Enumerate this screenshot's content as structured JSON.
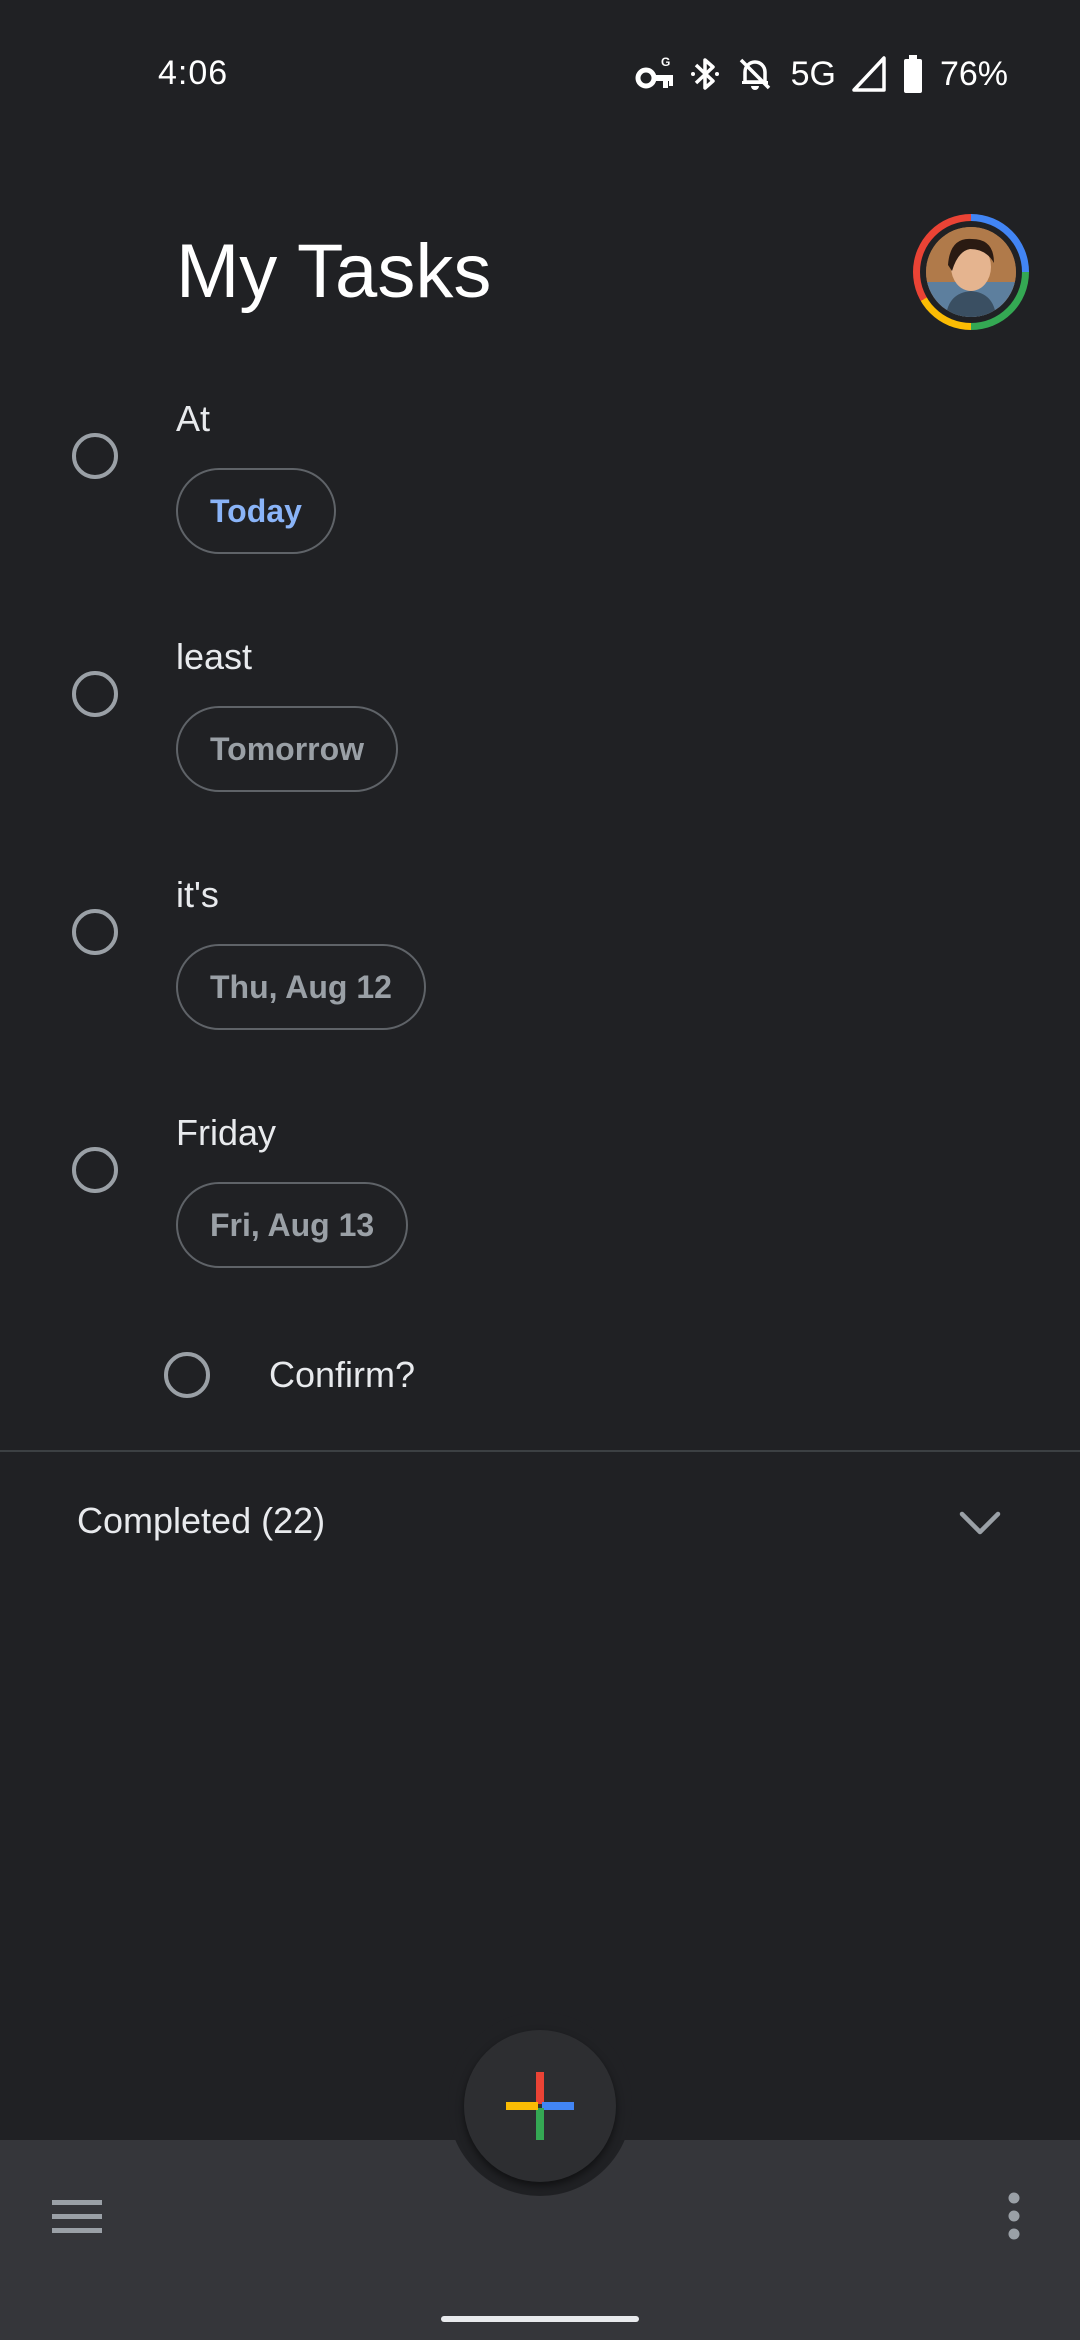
{
  "status_bar": {
    "time": "4:06",
    "network": "5G",
    "battery": "76%",
    "icons": [
      "vpn-key-icon",
      "bluetooth-icon",
      "notifications-off-icon",
      "signal-icon",
      "battery-icon"
    ]
  },
  "header": {
    "title": "My Tasks",
    "avatar": "account-avatar"
  },
  "tasks": [
    {
      "title": "At",
      "date": "Today",
      "date_color": "#8ab4f8"
    },
    {
      "title": "least",
      "date": "Tomorrow",
      "date_color": "#9aa0a6"
    },
    {
      "title": "it's",
      "date": "Thu, Aug 12",
      "date_color": "#9aa0a6"
    },
    {
      "title": "Friday",
      "date": "Fri, Aug 13",
      "date_color": "#9aa0a6"
    }
  ],
  "subtask": {
    "title": "Confirm?"
  },
  "completed": {
    "label": "Completed (22)"
  },
  "fab": {
    "icon": "add-icon",
    "colors": [
      "#ea4335",
      "#4285f4",
      "#34a853",
      "#fbbc04"
    ]
  },
  "bottom_bar": {
    "menu_icon": "menu-icon",
    "more_icon": "more-vert-icon"
  },
  "theme": {
    "background": "#202124",
    "bottom_bar": "#35363a",
    "accent": "#8ab4f8"
  }
}
